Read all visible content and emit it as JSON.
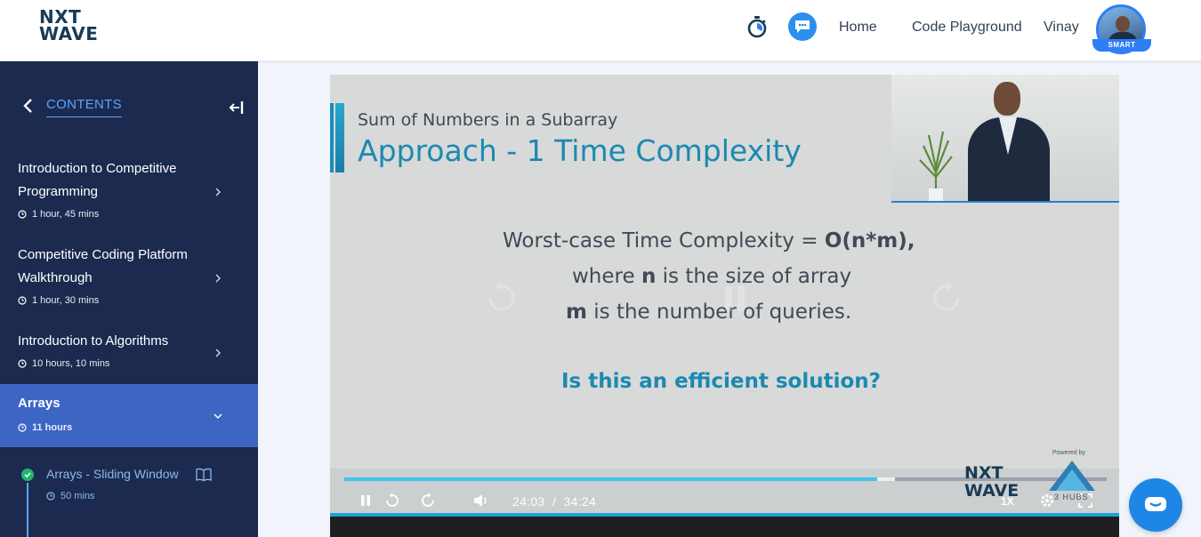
{
  "header": {
    "logo_line1": "NXT",
    "logo_line2": "WAVE",
    "nav": {
      "home": "Home",
      "code_playground": "Code Playground",
      "user_name": "Vinay"
    },
    "badge": "SMART",
    "icons": [
      "stopwatch-icon",
      "chat-bubble-icon"
    ]
  },
  "sidebar": {
    "title": "CONTENTS",
    "courses": [
      {
        "title": "Introduction to Competitive Programming",
        "duration": "1 hour, 45 mins"
      },
      {
        "title": "Competitive Coding Platform Walkthrough",
        "duration": "1 hour, 30 mins"
      },
      {
        "title": "Introduction to Algorithms",
        "duration": "10 hours, 10 mins"
      },
      {
        "title": "Arrays",
        "duration": "11 hours",
        "active": true
      }
    ],
    "sub_items": [
      {
        "title": "Arrays - Sliding Window",
        "duration": "50 mins",
        "completed": true
      }
    ]
  },
  "video": {
    "slide": {
      "subtitle": "Sum of Numbers in a Subarray",
      "title": "Approach - 1 Time Complexity",
      "line1_text": "Worst-case Time Complexity = ",
      "line1_bold": "O(n*m),",
      "line2_pre": "where ",
      "line2_bold": "n",
      "line2_post": " is the size of array",
      "line3_bold": "m",
      "line3_post": " is the number of queries.",
      "question": "Is this an efficient solution?"
    },
    "current_time": "24:03",
    "separator": "/",
    "total_time": "34:24",
    "progress_fraction": 0.6986,
    "buffer_fraction": 0.7226,
    "speed": "1X",
    "watermark_line1": "NXT",
    "watermark_line2": "WAVE",
    "powered_by": "Powered by",
    "hubs_label": "3 HUBS"
  },
  "colors": {
    "sidebar_bg": "#1b2a4e",
    "active_item": "#3d65c4",
    "accent_blue": "#5aa4ff",
    "slide_teal": "#1c89b0",
    "progress": "#3fc3ee",
    "complete_green": "#1fb56b"
  }
}
